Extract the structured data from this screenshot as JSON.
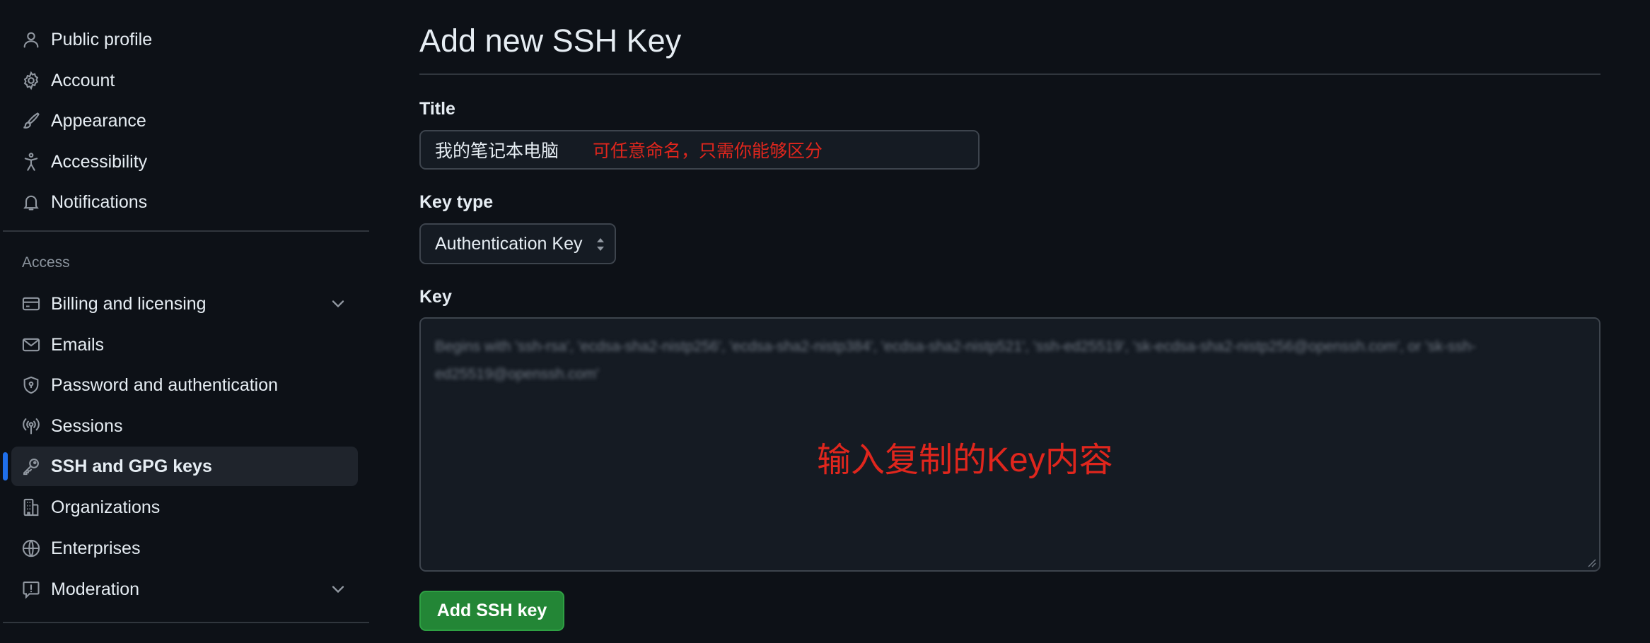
{
  "sidebar": {
    "items": [
      {
        "label": "Public profile",
        "icon": "person-icon"
      },
      {
        "label": "Account",
        "icon": "gear-icon"
      },
      {
        "label": "Appearance",
        "icon": "paintbrush-icon"
      },
      {
        "label": "Accessibility",
        "icon": "accessibility-icon"
      },
      {
        "label": "Notifications",
        "icon": "bell-icon"
      }
    ],
    "access_section_label": "Access",
    "access_items": [
      {
        "label": "Billing and licensing",
        "icon": "credit-card-icon",
        "expandable": true
      },
      {
        "label": "Emails",
        "icon": "mail-icon"
      },
      {
        "label": "Password and authentication",
        "icon": "shield-lock-icon"
      },
      {
        "label": "Sessions",
        "icon": "broadcast-icon"
      },
      {
        "label": "SSH and GPG keys",
        "icon": "key-icon",
        "active": true
      },
      {
        "label": "Organizations",
        "icon": "organization-icon"
      },
      {
        "label": "Enterprises",
        "icon": "globe-icon"
      },
      {
        "label": "Moderation",
        "icon": "report-icon",
        "expandable": true
      }
    ]
  },
  "main": {
    "title": "Add new SSH Key",
    "title_field": {
      "label": "Title",
      "value": "我的笔记本电脑",
      "annotation": "可任意命名，只需你能够区分"
    },
    "key_type": {
      "label": "Key type",
      "selected": "Authentication Key"
    },
    "key_field": {
      "label": "Key",
      "placeholder": "Begins with 'ssh-rsa', 'ecdsa-sha2-nistp256', 'ecdsa-sha2-nistp384', 'ecdsa-sha2-nistp521', 'ssh-ed25519', 'sk-ecdsa-sha2-nistp256@openssh.com', or 'sk-ssh-ed25519@openssh.com'",
      "annotation": "输入复制的Key内容"
    },
    "submit_label": "Add SSH key"
  },
  "colors": {
    "background": "#0d1117",
    "accent_active": "#1f6feb",
    "button_green": "#238636",
    "annotation_red": "#e0261d"
  }
}
